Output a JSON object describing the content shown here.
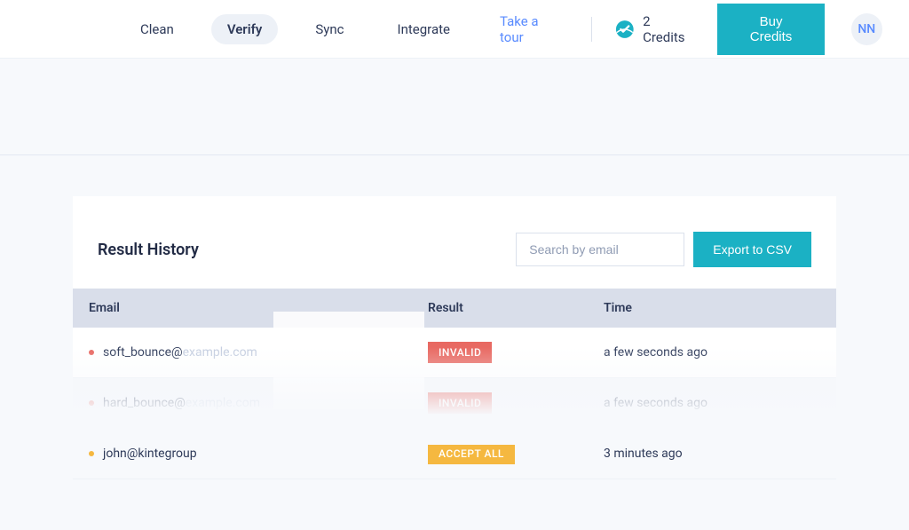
{
  "header": {
    "nav": [
      {
        "label": "Clean",
        "active": false
      },
      {
        "label": "Verify",
        "active": true
      },
      {
        "label": "Sync",
        "active": false
      },
      {
        "label": "Integrate",
        "active": false
      }
    ],
    "tour_label": "Take a tour",
    "credits_text": "2 Credits",
    "buy_credits_label": "Buy Credits",
    "avatar_initials": "NN"
  },
  "card": {
    "title": "Result History",
    "search_placeholder": "Search by email",
    "export_label": "Export to CSV",
    "columns": {
      "email": "Email",
      "result": "Result",
      "time": "Time"
    },
    "rows": [
      {
        "dot_color": "red",
        "email_visible": "soft_bounce@",
        "email_faded": "example.com",
        "result_label": "INVALID",
        "result_type": "invalid",
        "time": "a few seconds ago"
      },
      {
        "dot_color": "red",
        "email_visible": "hard_bounce@",
        "email_faded": "example.com",
        "result_label": "INVALID",
        "result_type": "invalid",
        "time": "a few seconds ago"
      },
      {
        "dot_color": "yellow",
        "email_visible": "john@kintegroup",
        "email_faded": "",
        "result_label": "ACCEPT ALL",
        "result_type": "accept",
        "time": "3 minutes ago"
      }
    ]
  }
}
